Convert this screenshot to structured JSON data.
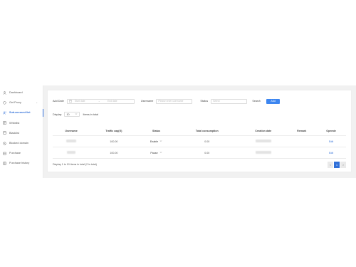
{
  "sidebar": {
    "items": [
      {
        "label": "Dashboard",
        "icon": "user-icon"
      },
      {
        "label": "Get Proxy",
        "icon": "shield-icon",
        "has_chevron": true
      },
      {
        "label": "Sub-account list",
        "icon": "users-icon",
        "active": true
      },
      {
        "label": "Whitelist",
        "icon": "list-icon"
      },
      {
        "label": "Blacklist",
        "icon": "block-icon"
      },
      {
        "label": "Blocked domain",
        "icon": "ban-icon"
      },
      {
        "label": "Purchase",
        "icon": "cart-icon"
      },
      {
        "label": "Purchase history",
        "icon": "history-icon"
      }
    ]
  },
  "filters": {
    "add_date_label": "Add Date",
    "start_placeholder": "Start date",
    "end_placeholder": "End date",
    "separator": "→",
    "username_label": "Username",
    "username_placeholder": "Please enter username",
    "status_label": "Status",
    "status_placeholder": "Select",
    "search_label": "Search",
    "add_label": "Add"
  },
  "display": {
    "label": "Display",
    "value": "10",
    "suffix": "Items in total"
  },
  "table": {
    "columns": [
      "Username",
      "Traffic cap(G)",
      "Status",
      "Total consumption",
      "Creation date",
      "Remark",
      "Operate"
    ],
    "rows": [
      {
        "username": "",
        "traffic_cap": "100.00",
        "status": "Enable",
        "total": "0.00",
        "created": "",
        "remark": "",
        "operate": "Edit"
      },
      {
        "username": "",
        "traffic_cap": "100.00",
        "status": "Pause",
        "total": "0.00",
        "created": "",
        "remark": "",
        "operate": "Edit"
      }
    ]
  },
  "footer": {
    "info": "Display 1 to 10 items in total (2 in total)",
    "pages": [
      "<",
      "1",
      ">"
    ],
    "current_page": "1"
  },
  "colors": {
    "accent": "#2f6fd8",
    "add_button": "#3d86f0",
    "main_bg": "#f1f1f1"
  }
}
